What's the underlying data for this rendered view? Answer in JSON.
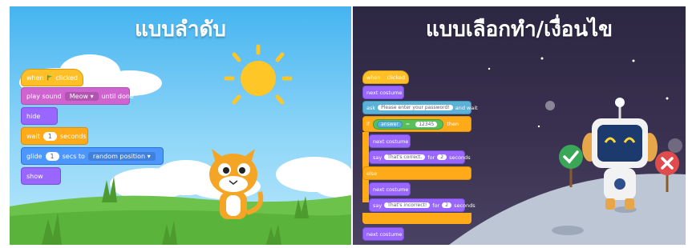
{
  "left_panel": {
    "title": "แบบลำดับ",
    "blocks": {
      "when_clicked": {
        "pre": "when",
        "post": "clicked"
      },
      "play_sound": {
        "pre": "play sound",
        "sound": "Meow ▾",
        "post": "until done"
      },
      "hide": "hide",
      "wait": {
        "pre": "wait",
        "value": "1",
        "post": "seconds"
      },
      "glide": {
        "pre": "glide",
        "value": "1",
        "mid": "secs to",
        "target": "random position ▾"
      },
      "show": "show"
    }
  },
  "right_panel": {
    "title": "แบบเลือกทำ/เงื่อนไข",
    "blocks": {
      "when_clicked": {
        "pre": "when",
        "post": "clicked"
      },
      "next_costume_1": "next costume",
      "ask": {
        "pre": "ask",
        "question": "Please enter your password!",
        "post": "and wait"
      },
      "if": {
        "pre": "if",
        "sensor": "answer",
        "op": "=",
        "value": "12345",
        "post": "then"
      },
      "next_costume_2": "next costume",
      "say_correct": {
        "pre": "say",
        "message": "That's correct.",
        "mid": "for",
        "value": "2",
        "post": "seconds"
      },
      "else": "else",
      "next_costume_3": "next costume",
      "say_incorrect": {
        "pre": "say",
        "message": "That's incorrect!",
        "mid": "for",
        "value": "2",
        "post": "seconds"
      },
      "next_costume_4": "next costume"
    }
  },
  "colors": {
    "events": "#ffbf26",
    "sound": "#cf63cf",
    "looks": "#9966ff",
    "control": "#ffab19",
    "motion": "#4c97ff",
    "sensing": "#5cb1d6",
    "operators": "#59c059"
  },
  "icons": [
    "green-flag-icon",
    "sun-icon",
    "cat-sprite",
    "robot-sprite",
    "check-sign-icon",
    "cross-sign-icon"
  ]
}
